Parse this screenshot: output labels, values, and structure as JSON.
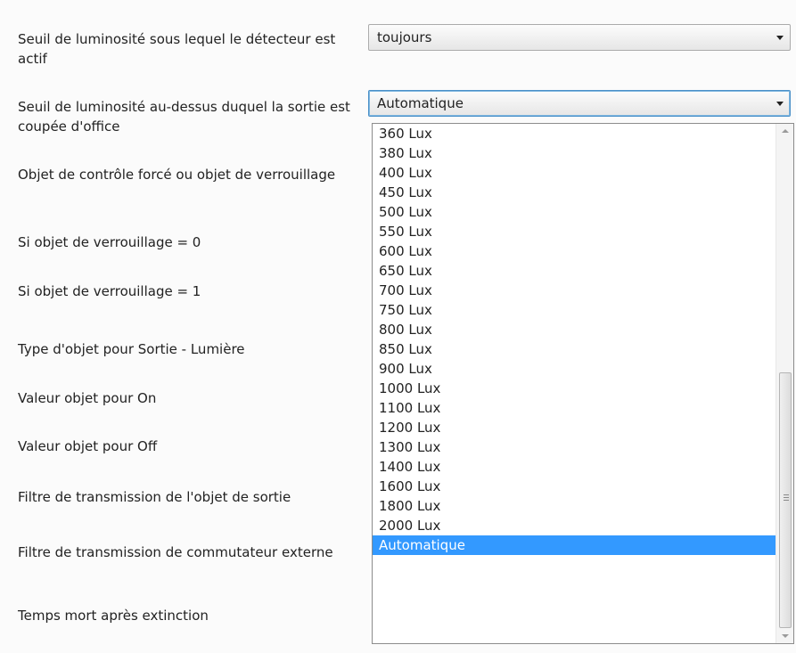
{
  "labels": [
    "Seuil de luminosité sous lequel le détecteur est actif",
    "Seuil de luminosité au-dessus duquel la sortie est coupée d'office",
    "Objet de contrôle forcé ou objet de verrouillage",
    "Si objet de verrouillage = 0",
    "Si objet de verrouillage = 1",
    "Type d'objet pour Sortie - Lumière",
    "Valeur objet pour On",
    "Valeur objet pour Off",
    "Filtre de transmission de l'objet de sortie",
    "Filtre de transmission de commutateur externe",
    "Temps mort après extinction"
  ],
  "combo1": {
    "value": "toujours"
  },
  "combo2": {
    "value": "Automatique"
  },
  "options": [
    "360 Lux",
    "380 Lux",
    "400 Lux",
    "450 Lux",
    "500 Lux",
    "550 Lux",
    "600 Lux",
    "650 Lux",
    "700 Lux",
    "750 Lux",
    "800 Lux",
    "850 Lux",
    "900 Lux",
    "1000 Lux",
    "1100 Lux",
    "1200 Lux",
    "1300 Lux",
    "1400 Lux",
    "1600 Lux",
    "1800 Lux",
    "2000 Lux",
    "Automatique"
  ],
  "selected_option": "Automatique"
}
